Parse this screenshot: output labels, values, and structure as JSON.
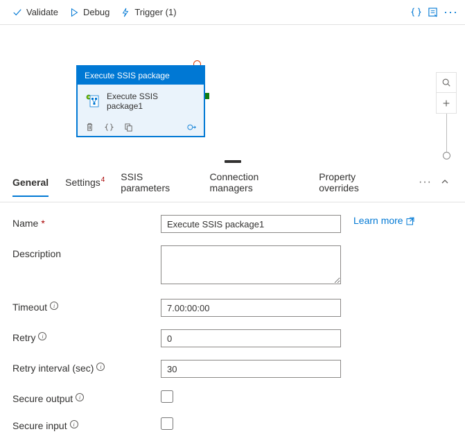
{
  "toolbar": {
    "validate": "Validate",
    "debug": "Debug",
    "trigger": "Trigger (1)"
  },
  "activity": {
    "header": "Execute SSIS package",
    "title": "Execute SSIS package1"
  },
  "tabs": {
    "general": "General",
    "settings": "Settings",
    "settings_badge": "4",
    "ssis_parameters": "SSIS parameters",
    "connection_managers": "Connection managers",
    "property_overrides": "Property overrides"
  },
  "form": {
    "name_label": "Name",
    "name_value": "Execute SSIS package1",
    "learn_more": "Learn more",
    "description_label": "Description",
    "description_value": "",
    "timeout_label": "Timeout",
    "timeout_value": "7.00:00:00",
    "retry_label": "Retry",
    "retry_value": "0",
    "retry_interval_label": "Retry interval (sec)",
    "retry_interval_value": "30",
    "secure_output_label": "Secure output",
    "secure_input_label": "Secure input"
  }
}
